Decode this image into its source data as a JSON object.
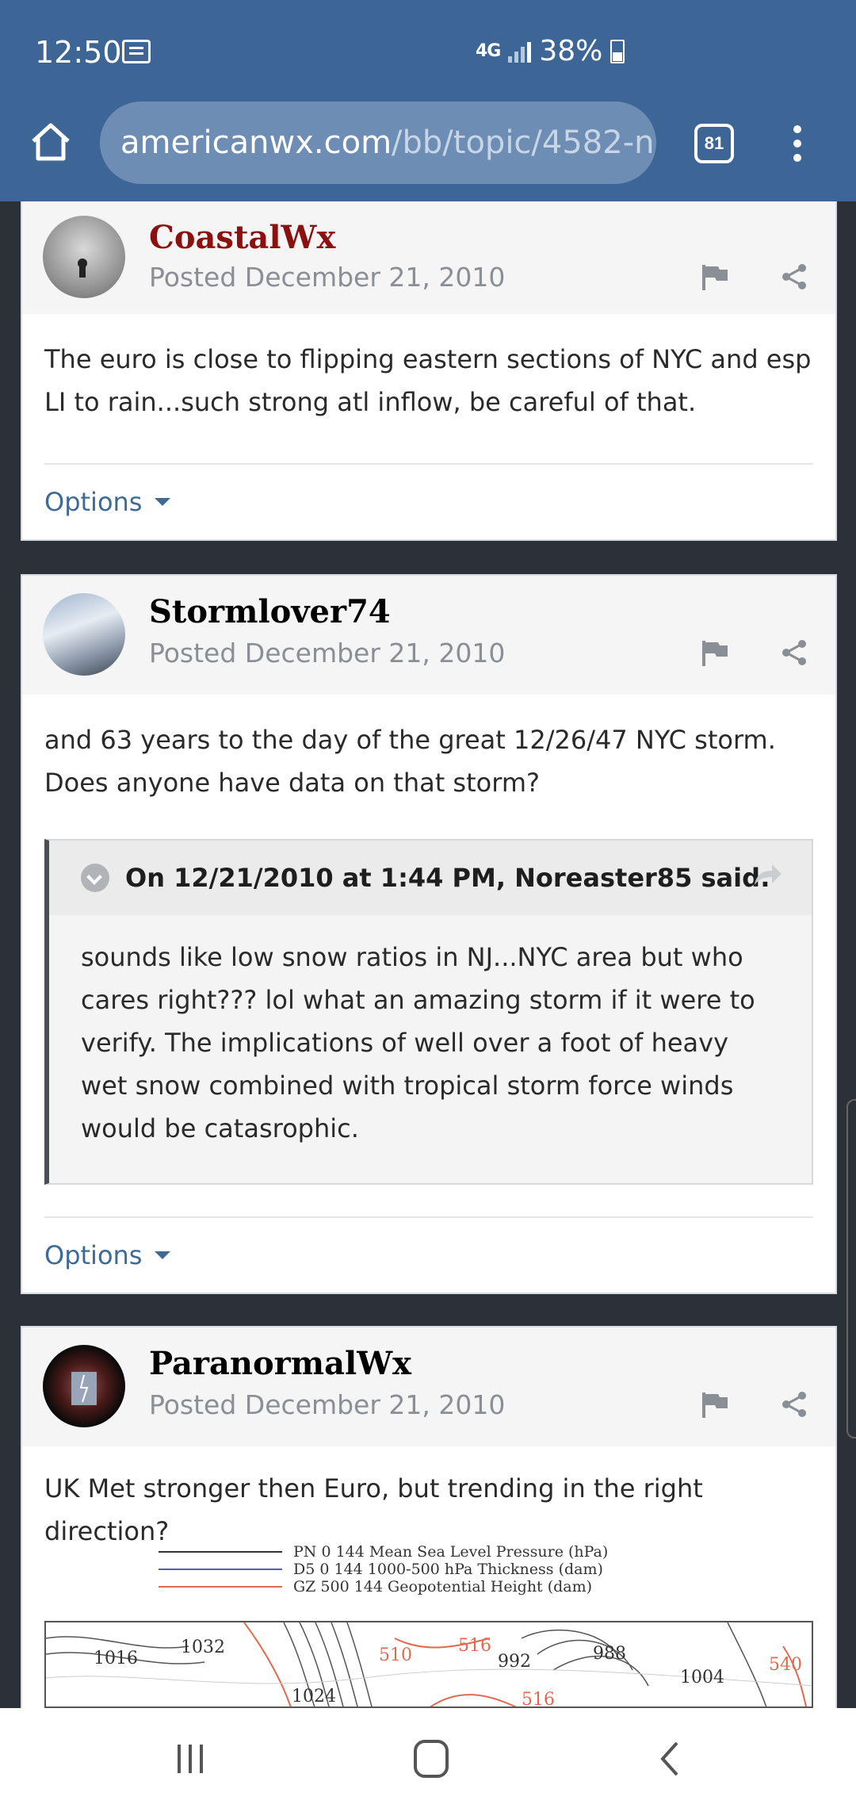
{
  "status_bar": {
    "time": "12:50",
    "network": "4G",
    "battery": "38%"
  },
  "browser": {
    "url_host": "americanwx.com",
    "url_path": "/bb/topic/4582-n",
    "tab_count": "81"
  },
  "posts": [
    {
      "author": "CoastalWx",
      "posted": "Posted December 21, 2010",
      "body": "The euro is close to flipping eastern sections of NYC and esp LI to rain...such strong atl inflow, be careful of that.",
      "options_label": "Options"
    },
    {
      "author": "Stormlover74",
      "posted": "Posted December 21, 2010",
      "body": "and 63 years to the day of the great 12/26/47 NYC storm. Does anyone have data on that storm?",
      "quote": {
        "header": "On 12/21/2010 at 1:44 PM, Noreaster85 said:",
        "body": "sounds like low snow ratios in NJ...NYC area but who cares right??? lol what an amazing storm if it were to verify. The implications of well over a foot of heavy wet snow combined with tropical storm force winds would be catasrophic."
      },
      "options_label": "Options"
    },
    {
      "author": "ParanormalWx",
      "posted": "Posted December 21, 2010",
      "body": "UK Met stronger then Euro, but trending in the right direction?",
      "map_legend": [
        "PN 0 144 Mean Sea Level Pressure (hPa)",
        "D5 0 144 1000-500 hPa Thickness (dam)",
        "GZ 500 144 Geopotential Height (dam)"
      ],
      "map_labels": [
        "1016",
        "1032",
        "1024",
        "510",
        "516",
        "992",
        "988",
        "1004",
        "540",
        "516"
      ]
    }
  ],
  "colors": {
    "header_bg": "#3d6595",
    "link": "#3f6a96",
    "author_red": "#8b1010",
    "legend_pressure": "#333333",
    "legend_thickness": "#5b5ba8",
    "legend_height": "#e06a50"
  },
  "icons": [
    "home-icon",
    "tabs-icon",
    "menu-icon",
    "flag-icon",
    "share-icon",
    "quote-toggle-icon",
    "quote-link-icon",
    "recents-icon",
    "home-nav-icon",
    "back-icon"
  ]
}
